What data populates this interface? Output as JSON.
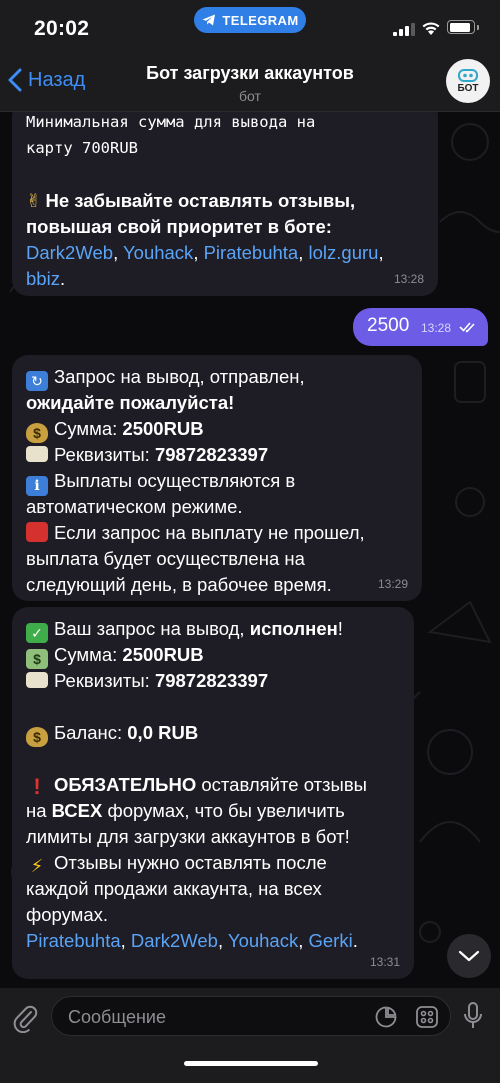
{
  "status_bar": {
    "time": "20:02",
    "telegram_pill": "TELEGRAM"
  },
  "header": {
    "back_label": "Назад",
    "title": "Бот загрузки аккаунтов",
    "subtitle": "бот",
    "avatar_text": "БОТ"
  },
  "messages": {
    "m1": {
      "line1": "Минимальная сумма для вывода на",
      "line2": "карту 700RUB",
      "emoji": "✌",
      "line3": "Не забывайте оставлять отзывы,",
      "line4": "повышая свой приоритет в боте:",
      "links": [
        "Dark2Web",
        "Youhack",
        "Piratebuhta",
        "lolz.guru",
        "bbiz"
      ],
      "sep": ", ",
      "end": ".",
      "time": "13:28"
    },
    "m2": {
      "text": "2500",
      "time": "13:28"
    },
    "m3": {
      "l1": "Запрос на вывод,  отправлен,",
      "l2": "ожидайте пожалуйста!",
      "l3_label": "Сумма: ",
      "l3_value": "2500RUB",
      "l4_label": "Реквизиты: ",
      "l4_value": "79872823397",
      "l5": "Выплаты осуществляются в",
      "l6": "автоматическом режиме.",
      "l7": "Если запрос на выплату не прошел,",
      "l8": "выплата будет осуществлена на",
      "l9": "следующий день, в рабочее время.",
      "time": "13:29"
    },
    "m4": {
      "l1_a": "Ваш запрос на вывод, ",
      "l1_b": "исполнен",
      "l1_c": "!",
      "l2_label": "Сумма: ",
      "l2_value": "2500RUB",
      "l3_label": "Реквизиты: ",
      "l3_value": "79872823397",
      "l4_label": "Баланс: ",
      "l4_value": "0,0 RUB",
      "l5_bold": "ОБЯЗАТЕЛЬНО",
      "l5_rest": " оставляйте отзывы",
      "l6_a": "на ",
      "l6_bold": "ВСЕХ",
      "l6_rest": " форумах, что бы увеличить",
      "l7": "лимиты для загрузки аккаунтов в бот!",
      "l8": "Отзывы нужно оставлять после",
      "l9": "каждой продажи аккаунта, на всех",
      "l10": "форумах.",
      "links": [
        "Piratebuhta",
        "Dark2Web",
        "Youhack",
        "Gerki"
      ],
      "sep": ", ",
      "end": ".",
      "time": "13:31"
    }
  },
  "input": {
    "placeholder": "Сообщение"
  },
  "icons": {
    "refresh": "arrows-clockwise-icon",
    "money_bag": "money-bag-icon",
    "card": "credit-card-icon",
    "info": "info-icon",
    "red_square": "red-square-icon",
    "check": "check-mark-icon",
    "money_wings": "money-with-wings-icon",
    "exclamation": "exclamation-icon",
    "lightning": "lightning-icon"
  },
  "colors": {
    "accent": "#3e8ef7",
    "outgoing_bubble": "#6d5ce6",
    "incoming_bubble": "#1e1c24",
    "link": "#5aa4f7"
  }
}
